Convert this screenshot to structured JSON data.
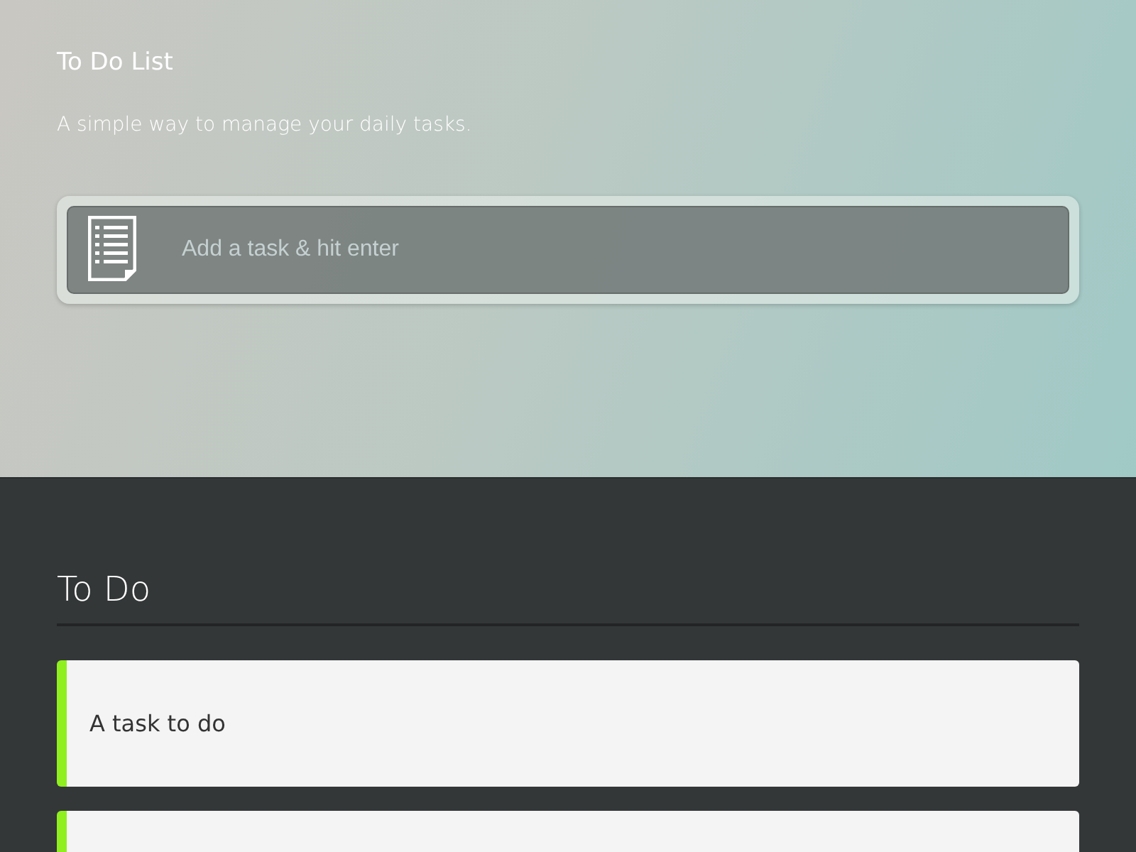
{
  "header": {
    "title": "To Do List",
    "subtitle": "A simple way to manage your daily tasks."
  },
  "task_input": {
    "placeholder": "Add a task & hit enter"
  },
  "todo_section": {
    "heading": "To Do",
    "tasks": [
      {
        "kind": "task",
        "text": "A task to do"
      },
      {
        "kind": "cut-off"
      }
    ]
  }
}
